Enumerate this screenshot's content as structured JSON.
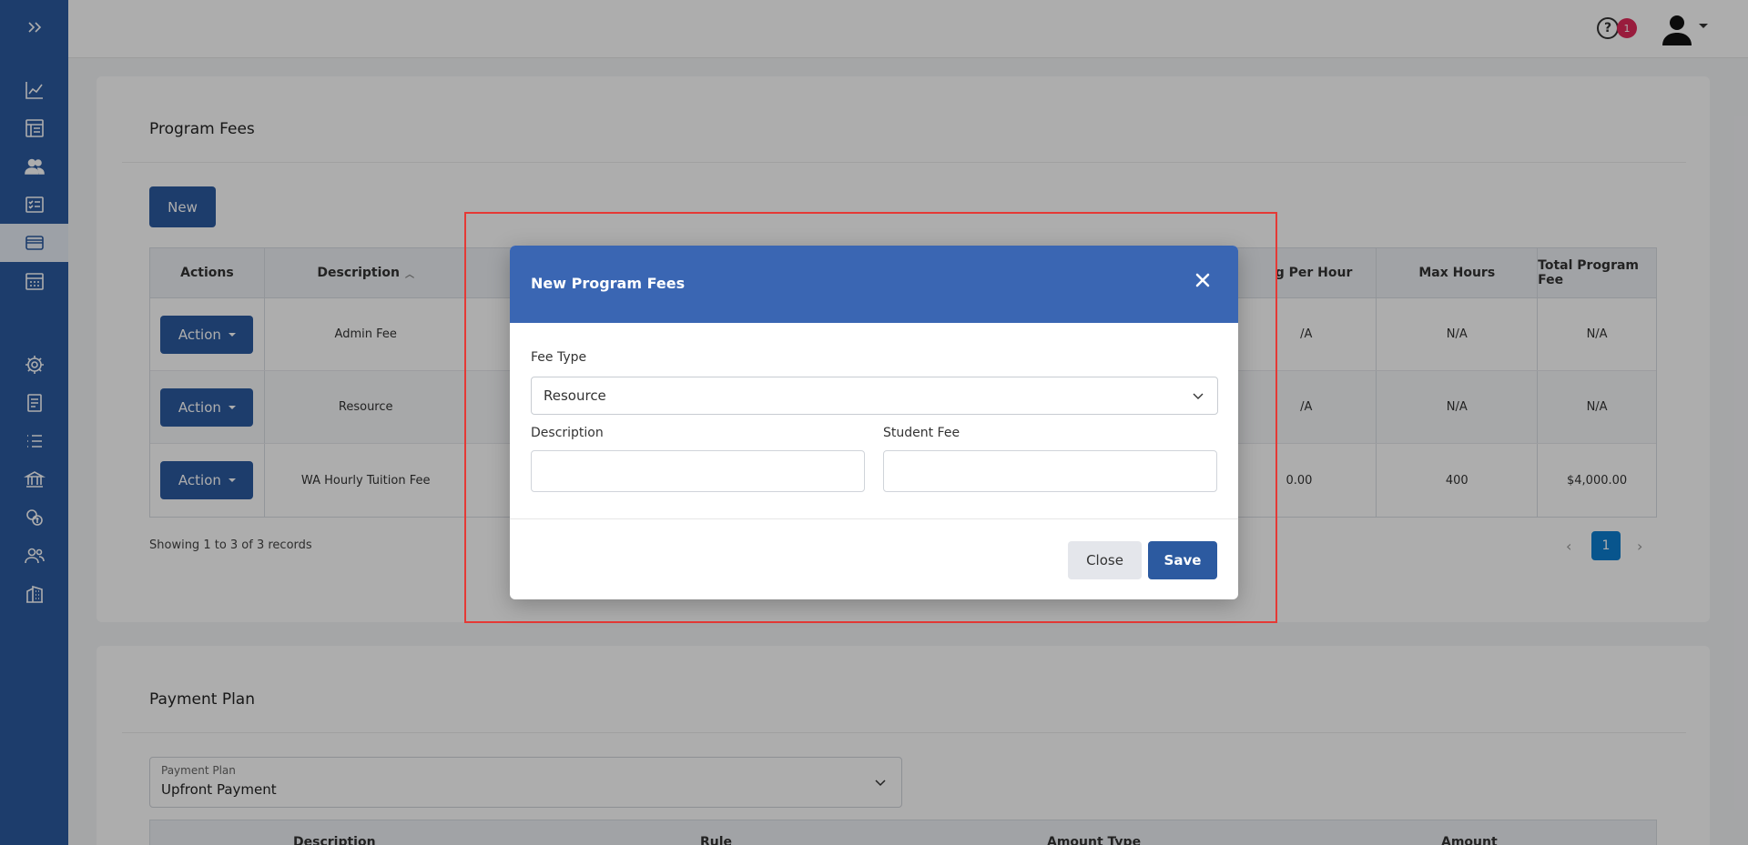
{
  "header": {
    "help_glyph": "?",
    "notification_count": "1"
  },
  "sidebar": {
    "items": [
      {
        "icon": "double-chevron-right-icon"
      },
      {
        "icon": "line-chart-icon"
      },
      {
        "icon": "table-icon"
      },
      {
        "icon": "users-icon"
      },
      {
        "icon": "checklist-icon"
      },
      {
        "icon": "credit-card-icon",
        "active": true
      },
      {
        "icon": "calendar-icon"
      },
      {
        "icon": "gear-icon"
      },
      {
        "icon": "document-icon"
      },
      {
        "icon": "list-icon"
      },
      {
        "icon": "bank-icon"
      },
      {
        "icon": "coins-icon"
      },
      {
        "icon": "user-group-icon"
      },
      {
        "icon": "building-icon"
      }
    ]
  },
  "program_fees": {
    "title": "Program Fees",
    "new_label": "New",
    "columns": {
      "actions": "Actions",
      "description": "Description",
      "per_hour": "g Per Hour",
      "max_hours": "Max Hours",
      "total": "Total Program Fee"
    },
    "rows": [
      {
        "action": "Action",
        "description": "Admin Fee",
        "per_hour": "/A",
        "max_hours": "N/A",
        "total": "N/A"
      },
      {
        "action": "Action",
        "description": "Resource",
        "per_hour": "/A",
        "max_hours": "N/A",
        "total": "N/A"
      },
      {
        "action": "Action",
        "description": "WA Hourly Tuition Fee",
        "per_hour": "0.00",
        "max_hours": "400",
        "total": "$4,000.00"
      }
    ],
    "records_text": "Showing 1 to 3 of 3 records",
    "pager": {
      "prev": "‹",
      "current": "1",
      "next": "›"
    }
  },
  "payment_plan": {
    "title": "Payment Plan",
    "select_label": "Payment Plan",
    "select_value": "Upfront Payment",
    "columns": [
      "Description",
      "Rule",
      "Amount Type",
      "Amount"
    ]
  },
  "modal": {
    "title": "New Program Fees",
    "close_glyph": "✕",
    "fee_type_label": "Fee Type",
    "fee_type_value": "Resource",
    "description_label": "Description",
    "description_value": "",
    "student_fee_label": "Student Fee",
    "student_fee_value": "",
    "close_label": "Close",
    "save_label": "Save"
  },
  "colors": {
    "primary": "#2c5aa0",
    "modal_header": "#3a66b3",
    "badge": "#e22a5a",
    "pager_active": "#0d7ed0",
    "highlight": "#e53935"
  }
}
